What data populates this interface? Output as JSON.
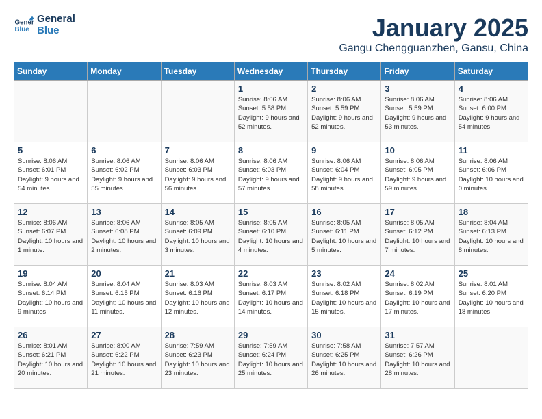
{
  "header": {
    "logo_line1": "General",
    "logo_line2": "Blue",
    "month": "January 2025",
    "location": "Gangu Chengguanzhen, Gansu, China"
  },
  "weekdays": [
    "Sunday",
    "Monday",
    "Tuesday",
    "Wednesday",
    "Thursday",
    "Friday",
    "Saturday"
  ],
  "weeks": [
    [
      {
        "day": "",
        "text": ""
      },
      {
        "day": "",
        "text": ""
      },
      {
        "day": "",
        "text": ""
      },
      {
        "day": "1",
        "text": "Sunrise: 8:06 AM\nSunset: 5:58 PM\nDaylight: 9 hours and 52 minutes."
      },
      {
        "day": "2",
        "text": "Sunrise: 8:06 AM\nSunset: 5:59 PM\nDaylight: 9 hours and 52 minutes."
      },
      {
        "day": "3",
        "text": "Sunrise: 8:06 AM\nSunset: 5:59 PM\nDaylight: 9 hours and 53 minutes."
      },
      {
        "day": "4",
        "text": "Sunrise: 8:06 AM\nSunset: 6:00 PM\nDaylight: 9 hours and 54 minutes."
      }
    ],
    [
      {
        "day": "5",
        "text": "Sunrise: 8:06 AM\nSunset: 6:01 PM\nDaylight: 9 hours and 54 minutes."
      },
      {
        "day": "6",
        "text": "Sunrise: 8:06 AM\nSunset: 6:02 PM\nDaylight: 9 hours and 55 minutes."
      },
      {
        "day": "7",
        "text": "Sunrise: 8:06 AM\nSunset: 6:03 PM\nDaylight: 9 hours and 56 minutes."
      },
      {
        "day": "8",
        "text": "Sunrise: 8:06 AM\nSunset: 6:03 PM\nDaylight: 9 hours and 57 minutes."
      },
      {
        "day": "9",
        "text": "Sunrise: 8:06 AM\nSunset: 6:04 PM\nDaylight: 9 hours and 58 minutes."
      },
      {
        "day": "10",
        "text": "Sunrise: 8:06 AM\nSunset: 6:05 PM\nDaylight: 9 hours and 59 minutes."
      },
      {
        "day": "11",
        "text": "Sunrise: 8:06 AM\nSunset: 6:06 PM\nDaylight: 10 hours and 0 minutes."
      }
    ],
    [
      {
        "day": "12",
        "text": "Sunrise: 8:06 AM\nSunset: 6:07 PM\nDaylight: 10 hours and 1 minute."
      },
      {
        "day": "13",
        "text": "Sunrise: 8:06 AM\nSunset: 6:08 PM\nDaylight: 10 hours and 2 minutes."
      },
      {
        "day": "14",
        "text": "Sunrise: 8:05 AM\nSunset: 6:09 PM\nDaylight: 10 hours and 3 minutes."
      },
      {
        "day": "15",
        "text": "Sunrise: 8:05 AM\nSunset: 6:10 PM\nDaylight: 10 hours and 4 minutes."
      },
      {
        "day": "16",
        "text": "Sunrise: 8:05 AM\nSunset: 6:11 PM\nDaylight: 10 hours and 5 minutes."
      },
      {
        "day": "17",
        "text": "Sunrise: 8:05 AM\nSunset: 6:12 PM\nDaylight: 10 hours and 7 minutes."
      },
      {
        "day": "18",
        "text": "Sunrise: 8:04 AM\nSunset: 6:13 PM\nDaylight: 10 hours and 8 minutes."
      }
    ],
    [
      {
        "day": "19",
        "text": "Sunrise: 8:04 AM\nSunset: 6:14 PM\nDaylight: 10 hours and 9 minutes."
      },
      {
        "day": "20",
        "text": "Sunrise: 8:04 AM\nSunset: 6:15 PM\nDaylight: 10 hours and 11 minutes."
      },
      {
        "day": "21",
        "text": "Sunrise: 8:03 AM\nSunset: 6:16 PM\nDaylight: 10 hours and 12 minutes."
      },
      {
        "day": "22",
        "text": "Sunrise: 8:03 AM\nSunset: 6:17 PM\nDaylight: 10 hours and 14 minutes."
      },
      {
        "day": "23",
        "text": "Sunrise: 8:02 AM\nSunset: 6:18 PM\nDaylight: 10 hours and 15 minutes."
      },
      {
        "day": "24",
        "text": "Sunrise: 8:02 AM\nSunset: 6:19 PM\nDaylight: 10 hours and 17 minutes."
      },
      {
        "day": "25",
        "text": "Sunrise: 8:01 AM\nSunset: 6:20 PM\nDaylight: 10 hours and 18 minutes."
      }
    ],
    [
      {
        "day": "26",
        "text": "Sunrise: 8:01 AM\nSunset: 6:21 PM\nDaylight: 10 hours and 20 minutes."
      },
      {
        "day": "27",
        "text": "Sunrise: 8:00 AM\nSunset: 6:22 PM\nDaylight: 10 hours and 21 minutes."
      },
      {
        "day": "28",
        "text": "Sunrise: 7:59 AM\nSunset: 6:23 PM\nDaylight: 10 hours and 23 minutes."
      },
      {
        "day": "29",
        "text": "Sunrise: 7:59 AM\nSunset: 6:24 PM\nDaylight: 10 hours and 25 minutes."
      },
      {
        "day": "30",
        "text": "Sunrise: 7:58 AM\nSunset: 6:25 PM\nDaylight: 10 hours and 26 minutes."
      },
      {
        "day": "31",
        "text": "Sunrise: 7:57 AM\nSunset: 6:26 PM\nDaylight: 10 hours and 28 minutes."
      },
      {
        "day": "",
        "text": ""
      }
    ]
  ]
}
